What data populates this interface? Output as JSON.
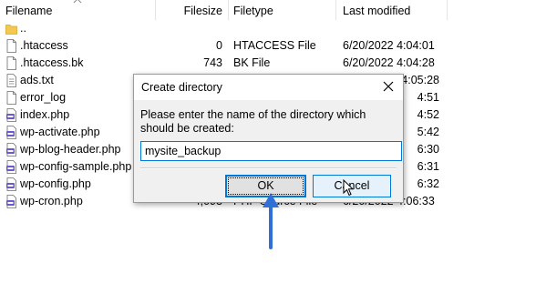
{
  "columns": {
    "filename": "Filename",
    "filesize": "Filesize",
    "filetype": "Filetype",
    "last_modified": "Last modified"
  },
  "files": [
    {
      "name": "..",
      "size": "",
      "type": "",
      "modified": "",
      "icon": "folder-icon"
    },
    {
      "name": ".htaccess",
      "size": "0",
      "type": "HTACCESS File",
      "modified": "6/20/2022 4:04:01",
      "icon": "file-icon"
    },
    {
      "name": ".htaccess.bk",
      "size": "743",
      "type": "BK File",
      "modified": "6/20/2022 4:04:28",
      "icon": "file-icon"
    },
    {
      "name": "ads.txt",
      "size": "",
      "type": "",
      "modified": "4:05:28",
      "icon": "text-file-icon"
    },
    {
      "name": "error_log",
      "size": "",
      "type": "",
      "modified": "4:51",
      "icon": "file-icon"
    },
    {
      "name": "index.php",
      "size": "",
      "type": "",
      "modified": "4:52",
      "icon": "php-file-icon"
    },
    {
      "name": "wp-activate.php",
      "size": "",
      "type": "",
      "modified": "5:42",
      "icon": "php-file-icon"
    },
    {
      "name": "wp-blog-header.php",
      "size": "",
      "type": "",
      "modified": "6:30",
      "icon": "php-file-icon"
    },
    {
      "name": "wp-config-sample.php",
      "size": "",
      "type": "",
      "modified": "6:31",
      "icon": "php-file-icon"
    },
    {
      "name": "wp-config.php",
      "size": "",
      "type": "",
      "modified": "6:32",
      "icon": "php-file-icon"
    },
    {
      "name": "wp-cron.php",
      "size": "4,093",
      "type": "PHP Source File",
      "modified": "6/20/2022 4:06:33",
      "icon": "php-file-icon"
    }
  ],
  "dialog": {
    "title": "Create directory",
    "prompt": "Please enter the name of the directory which should be created:",
    "input_value": "mysite_backup",
    "ok_label": "OK",
    "cancel_label": "Cancel"
  },
  "colors": {
    "accent": "#0078d7",
    "annotation_arrow": "#2f6fd6",
    "folder": "#f2c94c",
    "php_icon": "#6a5acd"
  }
}
